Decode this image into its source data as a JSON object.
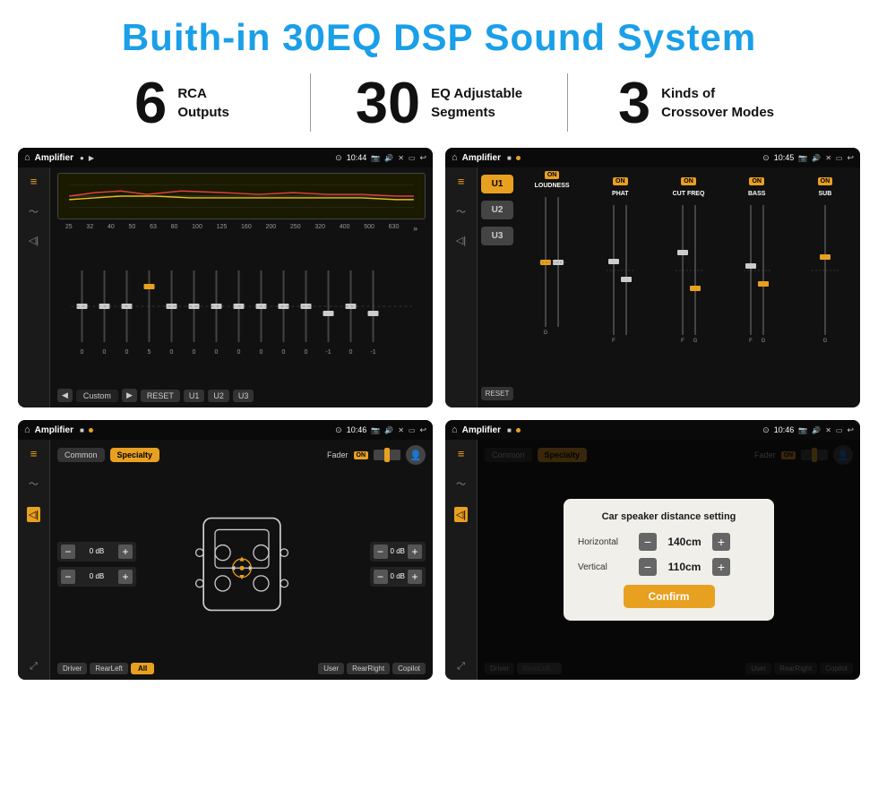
{
  "header": {
    "title": "Buith-in 30EQ DSP Sound System",
    "title_color": "#1a9fe8"
  },
  "stats": [
    {
      "number": "6",
      "label_line1": "RCA",
      "label_line2": "Outputs"
    },
    {
      "number": "30",
      "label_line1": "EQ Adjustable",
      "label_line2": "Segments"
    },
    {
      "number": "3",
      "label_line1": "Kinds of",
      "label_line2": "Crossover Modes"
    }
  ],
  "screens": [
    {
      "id": "eq-screen",
      "status_bar": {
        "app_name": "Amplifier",
        "time": "10:44",
        "icons": "▶"
      },
      "type": "equalizer",
      "freq_labels": [
        "25",
        "32",
        "40",
        "50",
        "63",
        "80",
        "100",
        "125",
        "160",
        "200",
        "250",
        "320",
        "400",
        "500",
        "630"
      ],
      "slider_values": [
        "0",
        "0",
        "0",
        "5",
        "0",
        "0",
        "0",
        "0",
        "0",
        "0",
        "0",
        "-1",
        "0",
        "-1"
      ],
      "controls": [
        "◀",
        "Custom",
        "▶",
        "RESET",
        "U1",
        "U2",
        "U3"
      ]
    },
    {
      "id": "crossover-screen",
      "status_bar": {
        "app_name": "Amplifier",
        "time": "10:45"
      },
      "type": "crossover",
      "presets": [
        "U1",
        "U2",
        "U3"
      ],
      "channels": [
        {
          "name": "LOUDNESS",
          "on": true
        },
        {
          "name": "PHAT",
          "on": true
        },
        {
          "name": "CUT FREQ",
          "on": true
        },
        {
          "name": "BASS",
          "on": true
        },
        {
          "name": "SUB",
          "on": true
        }
      ],
      "reset_label": "RESET"
    },
    {
      "id": "speaker-screen",
      "status_bar": {
        "app_name": "Amplifier",
        "time": "10:46"
      },
      "type": "speaker",
      "tabs": [
        "Common",
        "Specialty"
      ],
      "fader_label": "Fader",
      "fader_on": "ON",
      "db_values": [
        "0 dB",
        "0 dB",
        "0 dB",
        "0 dB"
      ],
      "positions": [
        "Driver",
        "RearLeft",
        "All",
        "User",
        "RearRight",
        "Copilot"
      ]
    },
    {
      "id": "dialog-screen",
      "status_bar": {
        "app_name": "Amplifier",
        "time": "10:46"
      },
      "type": "speaker-dialog",
      "dialog": {
        "title": "Car speaker distance setting",
        "horizontal_label": "Horizontal",
        "horizontal_value": "140cm",
        "vertical_label": "Vertical",
        "vertical_value": "110cm",
        "confirm_label": "Confirm"
      },
      "tabs": [
        "Common",
        "Specialty"
      ],
      "fader_on": "ON",
      "positions": [
        "Driver",
        "RearLeft",
        "All",
        "User",
        "RearRight",
        "Copilot"
      ]
    }
  ]
}
